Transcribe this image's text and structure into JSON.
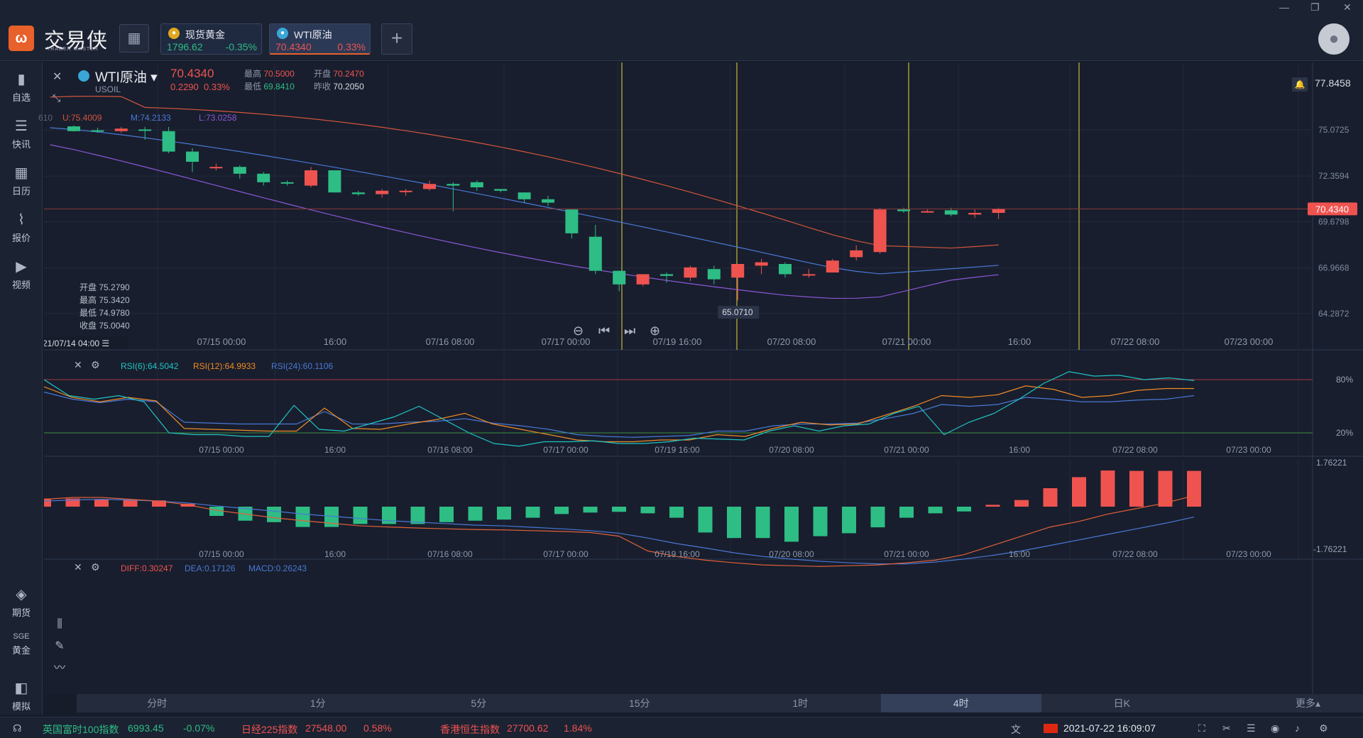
{
  "app": {
    "brand": "交易侠",
    "brand_sub": "TRADER MASTER",
    "logo_glyph": "ω"
  },
  "tabs": [
    {
      "name": "现货黄金",
      "price": "1796.62",
      "change": "-0.35%",
      "icon_color": "#e0a821",
      "price_color": "#2ebd85"
    },
    {
      "name": "WTI原油",
      "price": "70.4340",
      "change": "0.33%",
      "icon_color": "#3aa6d8",
      "price_color": "#ef5350"
    }
  ],
  "sidebar": {
    "top": [
      {
        "label": "自选",
        "icon": "bookmark-icon",
        "glyph": "▮"
      },
      {
        "label": "快讯",
        "icon": "news-icon",
        "glyph": "☰"
      },
      {
        "label": "日历",
        "icon": "calendar-icon",
        "glyph": "▦"
      },
      {
        "label": "报价",
        "icon": "quote-icon",
        "glyph": "⌇"
      },
      {
        "label": "视频",
        "icon": "video-icon",
        "glyph": "▶"
      }
    ],
    "bottom": [
      {
        "label": "期货",
        "icon": "futures-icon",
        "glyph": "◈"
      },
      {
        "label": "黄金",
        "icon": "gold-icon",
        "glyph": "SGE"
      },
      {
        "label": "模拟",
        "icon": "simulate-icon",
        "glyph": "◧"
      }
    ]
  },
  "instrument": {
    "name": "WTI原油",
    "code": "USOIL",
    "price": "70.4340",
    "change": "0.2290",
    "change_pct": "0.33%",
    "high_label": "最高",
    "high": "70.5000",
    "open_label": "开盘",
    "open": "70.2470",
    "low_label": "最低",
    "low": "69.8410",
    "prev_label": "昨收",
    "prev": "70.2050"
  },
  "boll_label": {
    "prefix": "610",
    "u": "U:75.4009",
    "m": "M:74.2133",
    "l": "L:73.0258"
  },
  "hover": {
    "open": "开盘 75.2790",
    "high": "最高 75.3420",
    "low": "最低 74.9780",
    "close": "收盘 75.0040"
  },
  "price_axis": [
    "75.0725",
    "72.3594",
    "69.6798",
    "66.9668",
    "64.2872"
  ],
  "price_axis_top": "77.8458",
  "current_price_tag": "70.4340",
  "low_marker": "65.0710",
  "crosshair_time": "21/07/14 04:00",
  "time_labels_main": [
    "07/15 00:00",
    "16:00",
    "07/16 08:00",
    "07/17 00:00",
    "07/19 16:00",
    "07/20 08:00",
    "07/21 00:00",
    "16:00",
    "07/22 08:00",
    "07/23 00:00"
  ],
  "time_labels_sub": [
    "07/15 00:00",
    "16:00",
    "07/16 08:00",
    "07/17 00:00",
    "07/19 16:00",
    "07/20 08:00",
    "07/21 00:00",
    "16:00",
    "07/22 08:00",
    "07/23 00:00"
  ],
  "rsi": {
    "l1": "RSI(6):64.5042",
    "l2": "RSI(12):64.9933",
    "l3": "RSI(24):60.1106",
    "hi": "80%",
    "lo": "20%",
    "rsi6": [
      80,
      62,
      58,
      62,
      55,
      20,
      18,
      18,
      16,
      16,
      51,
      24,
      22,
      30,
      38,
      50,
      35,
      20,
      8,
      5,
      10,
      10,
      11,
      8,
      8,
      10,
      14,
      13,
      12,
      22,
      28,
      22,
      28,
      30,
      42,
      50,
      18,
      32,
      42,
      58,
      76,
      89,
      84,
      85,
      80,
      82,
      79
    ],
    "rsi12": [
      72,
      60,
      55,
      60,
      56,
      25,
      24,
      23,
      22,
      22,
      48,
      25,
      24,
      30,
      35,
      42,
      30,
      24,
      18,
      12,
      10,
      10,
      12,
      12,
      18,
      16,
      25,
      32,
      29,
      30,
      40,
      50,
      62,
      60,
      63,
      73,
      69,
      60,
      62,
      68,
      70,
      70
    ],
    "rsi24": [
      66,
      58,
      54,
      58,
      55,
      32,
      31,
      30,
      30,
      30,
      44,
      30,
      30,
      32,
      33,
      36,
      31,
      28,
      24,
      18,
      16,
      15,
      16,
      17,
      22,
      22,
      28,
      30,
      30,
      31,
      36,
      42,
      52,
      50,
      52,
      60,
      58,
      55,
      55,
      57,
      58,
      62
    ]
  },
  "macd": {
    "l1": "DIFF:0.30247",
    "l2": "DEA:0.17126",
    "l3": "MACD:0.26243",
    "top": "1.76221",
    "bottom": "-1.76221",
    "hist": [
      0.22,
      0.22,
      0.2,
      0.18,
      0.17,
      0.08,
      -0.25,
      -0.38,
      -0.42,
      -0.55,
      -0.55,
      -0.47,
      -0.47,
      -0.47,
      -0.42,
      -0.38,
      -0.35,
      -0.3,
      -0.2,
      -0.16,
      -0.14,
      -0.18,
      -0.3,
      -0.7,
      -0.85,
      -0.85,
      -0.95,
      -0.8,
      -0.72,
      -0.56,
      -0.3,
      -0.18,
      -0.13,
      0.05,
      0.18,
      0.5,
      0.8,
      0.98,
      0.97,
      0.97,
      0.97
    ],
    "diff": [
      0.2,
      0.25,
      0.25,
      0.2,
      0.15,
      0.05,
      -0.1,
      -0.2,
      -0.3,
      -0.38,
      -0.45,
      -0.52,
      -0.55,
      -0.58,
      -0.6,
      -0.62,
      -0.63,
      -0.65,
      -0.67,
      -0.7,
      -0.8,
      -1.2,
      -1.35,
      -1.45,
      -1.52,
      -1.58,
      -1.6,
      -1.62,
      -1.6,
      -1.58,
      -1.52,
      -1.45,
      -1.3,
      -1.05,
      -0.8,
      -0.55,
      -0.4,
      -0.2,
      -0.05,
      0.1,
      0.3
    ],
    "dea": [
      0.15,
      0.18,
      0.2,
      0.18,
      0.15,
      0.1,
      0.02,
      -0.05,
      -0.12,
      -0.2,
      -0.26,
      -0.32,
      -0.38,
      -0.42,
      -0.46,
      -0.5,
      -0.52,
      -0.56,
      -0.6,
      -0.65,
      -0.72,
      -0.85,
      -1.0,
      -1.12,
      -1.25,
      -1.35,
      -1.42,
      -1.48,
      -1.52,
      -1.55,
      -1.55,
      -1.5,
      -1.42,
      -1.32,
      -1.2,
      -1.05,
      -0.9,
      -0.75,
      -0.6,
      -0.45,
      -0.28
    ]
  },
  "candles": [
    [
      75.28,
      75.0,
      75.34,
      74.97
    ],
    [
      75.05,
      75.0,
      75.2,
      74.9
    ],
    [
      75.0,
      75.15,
      75.25,
      74.9
    ],
    [
      75.1,
      75.05,
      75.25,
      74.5
    ],
    [
      75.0,
      73.8,
      75.25,
      73.7
    ],
    [
      73.8,
      73.2,
      74.0,
      72.6
    ],
    [
      72.9,
      72.9,
      73.1,
      72.7
    ],
    [
      72.9,
      72.5,
      73.0,
      72.2
    ],
    [
      72.5,
      72.0,
      72.6,
      71.8
    ],
    [
      72.0,
      71.95,
      72.1,
      71.8
    ],
    [
      71.8,
      72.7,
      72.9,
      71.7
    ],
    [
      72.7,
      71.4,
      72.7,
      71.4
    ],
    [
      71.4,
      71.3,
      71.5,
      71.2
    ],
    [
      71.3,
      71.5,
      71.6,
      71.1
    ],
    [
      71.5,
      71.5,
      71.6,
      71.2
    ],
    [
      71.6,
      71.9,
      72.1,
      71.5
    ],
    [
      71.9,
      71.8,
      72.0,
      70.3
    ],
    [
      72.0,
      71.7,
      72.1,
      71.5
    ],
    [
      71.6,
      71.5,
      71.6,
      71.4
    ],
    [
      71.4,
      71.0,
      71.4,
      70.8
    ],
    [
      71.0,
      70.8,
      71.2,
      70.6
    ],
    [
      70.4,
      69.0,
      70.4,
      68.7
    ],
    [
      68.8,
      66.8,
      69.5,
      66.6
    ],
    [
      66.8,
      66.0,
      66.8,
      65.6
    ],
    [
      66.0,
      66.6,
      66.6,
      65.9
    ],
    [
      66.6,
      66.5,
      66.7,
      66.1
    ],
    [
      66.4,
      67.0,
      67.1,
      66.2
    ],
    [
      66.9,
      66.3,
      67.1,
      66.0
    ],
    [
      66.4,
      67.2,
      67.2,
      65.07
    ],
    [
      67.1,
      67.3,
      67.5,
      66.6
    ],
    [
      67.2,
      66.6,
      67.3,
      66.4
    ],
    [
      66.6,
      66.6,
      66.9,
      66.4
    ],
    [
      66.7,
      67.4,
      67.5,
      66.7
    ],
    [
      67.6,
      68.0,
      68.3,
      67.4
    ],
    [
      67.9,
      70.4,
      70.5,
      67.8
    ],
    [
      70.4,
      70.3,
      70.5,
      70.2
    ],
    [
      70.3,
      70.3,
      70.4,
      70.2
    ],
    [
      70.35,
      70.1,
      70.5,
      70.0
    ],
    [
      70.1,
      70.2,
      70.4,
      69.9
    ],
    [
      70.2,
      70.43,
      70.5,
      69.84
    ]
  ],
  "bottom_tabs": [
    "分时",
    "1分",
    "5分",
    "15分",
    "1时",
    "4时",
    "日K",
    "更多▴"
  ],
  "active_tab": "4时",
  "ticker": [
    {
      "name": "英国富时100指数",
      "price": "6993.45",
      "chg": "-0.07%",
      "color": "#2ebd85"
    },
    {
      "name": "日经225指数",
      "price": "27548.00",
      "chg": "0.58%",
      "color": "#ef5350"
    },
    {
      "name": "香港恒生指数",
      "price": "27700.62",
      "chg": "1.84%",
      "color": "#ef5350"
    }
  ],
  "datetime": "2021-07-22 16:09:07",
  "colors": {
    "up": "#ef5350",
    "down": "#2ebd85",
    "boll_u": "#d4553d",
    "boll_m": "#4a78d6",
    "boll_l": "#8b57d8",
    "rsi6": "#20c4c4",
    "rsi12": "#f08a24",
    "rsi24": "#4a78d6",
    "grid": "#232b3d",
    "vline": "#e8d640"
  }
}
